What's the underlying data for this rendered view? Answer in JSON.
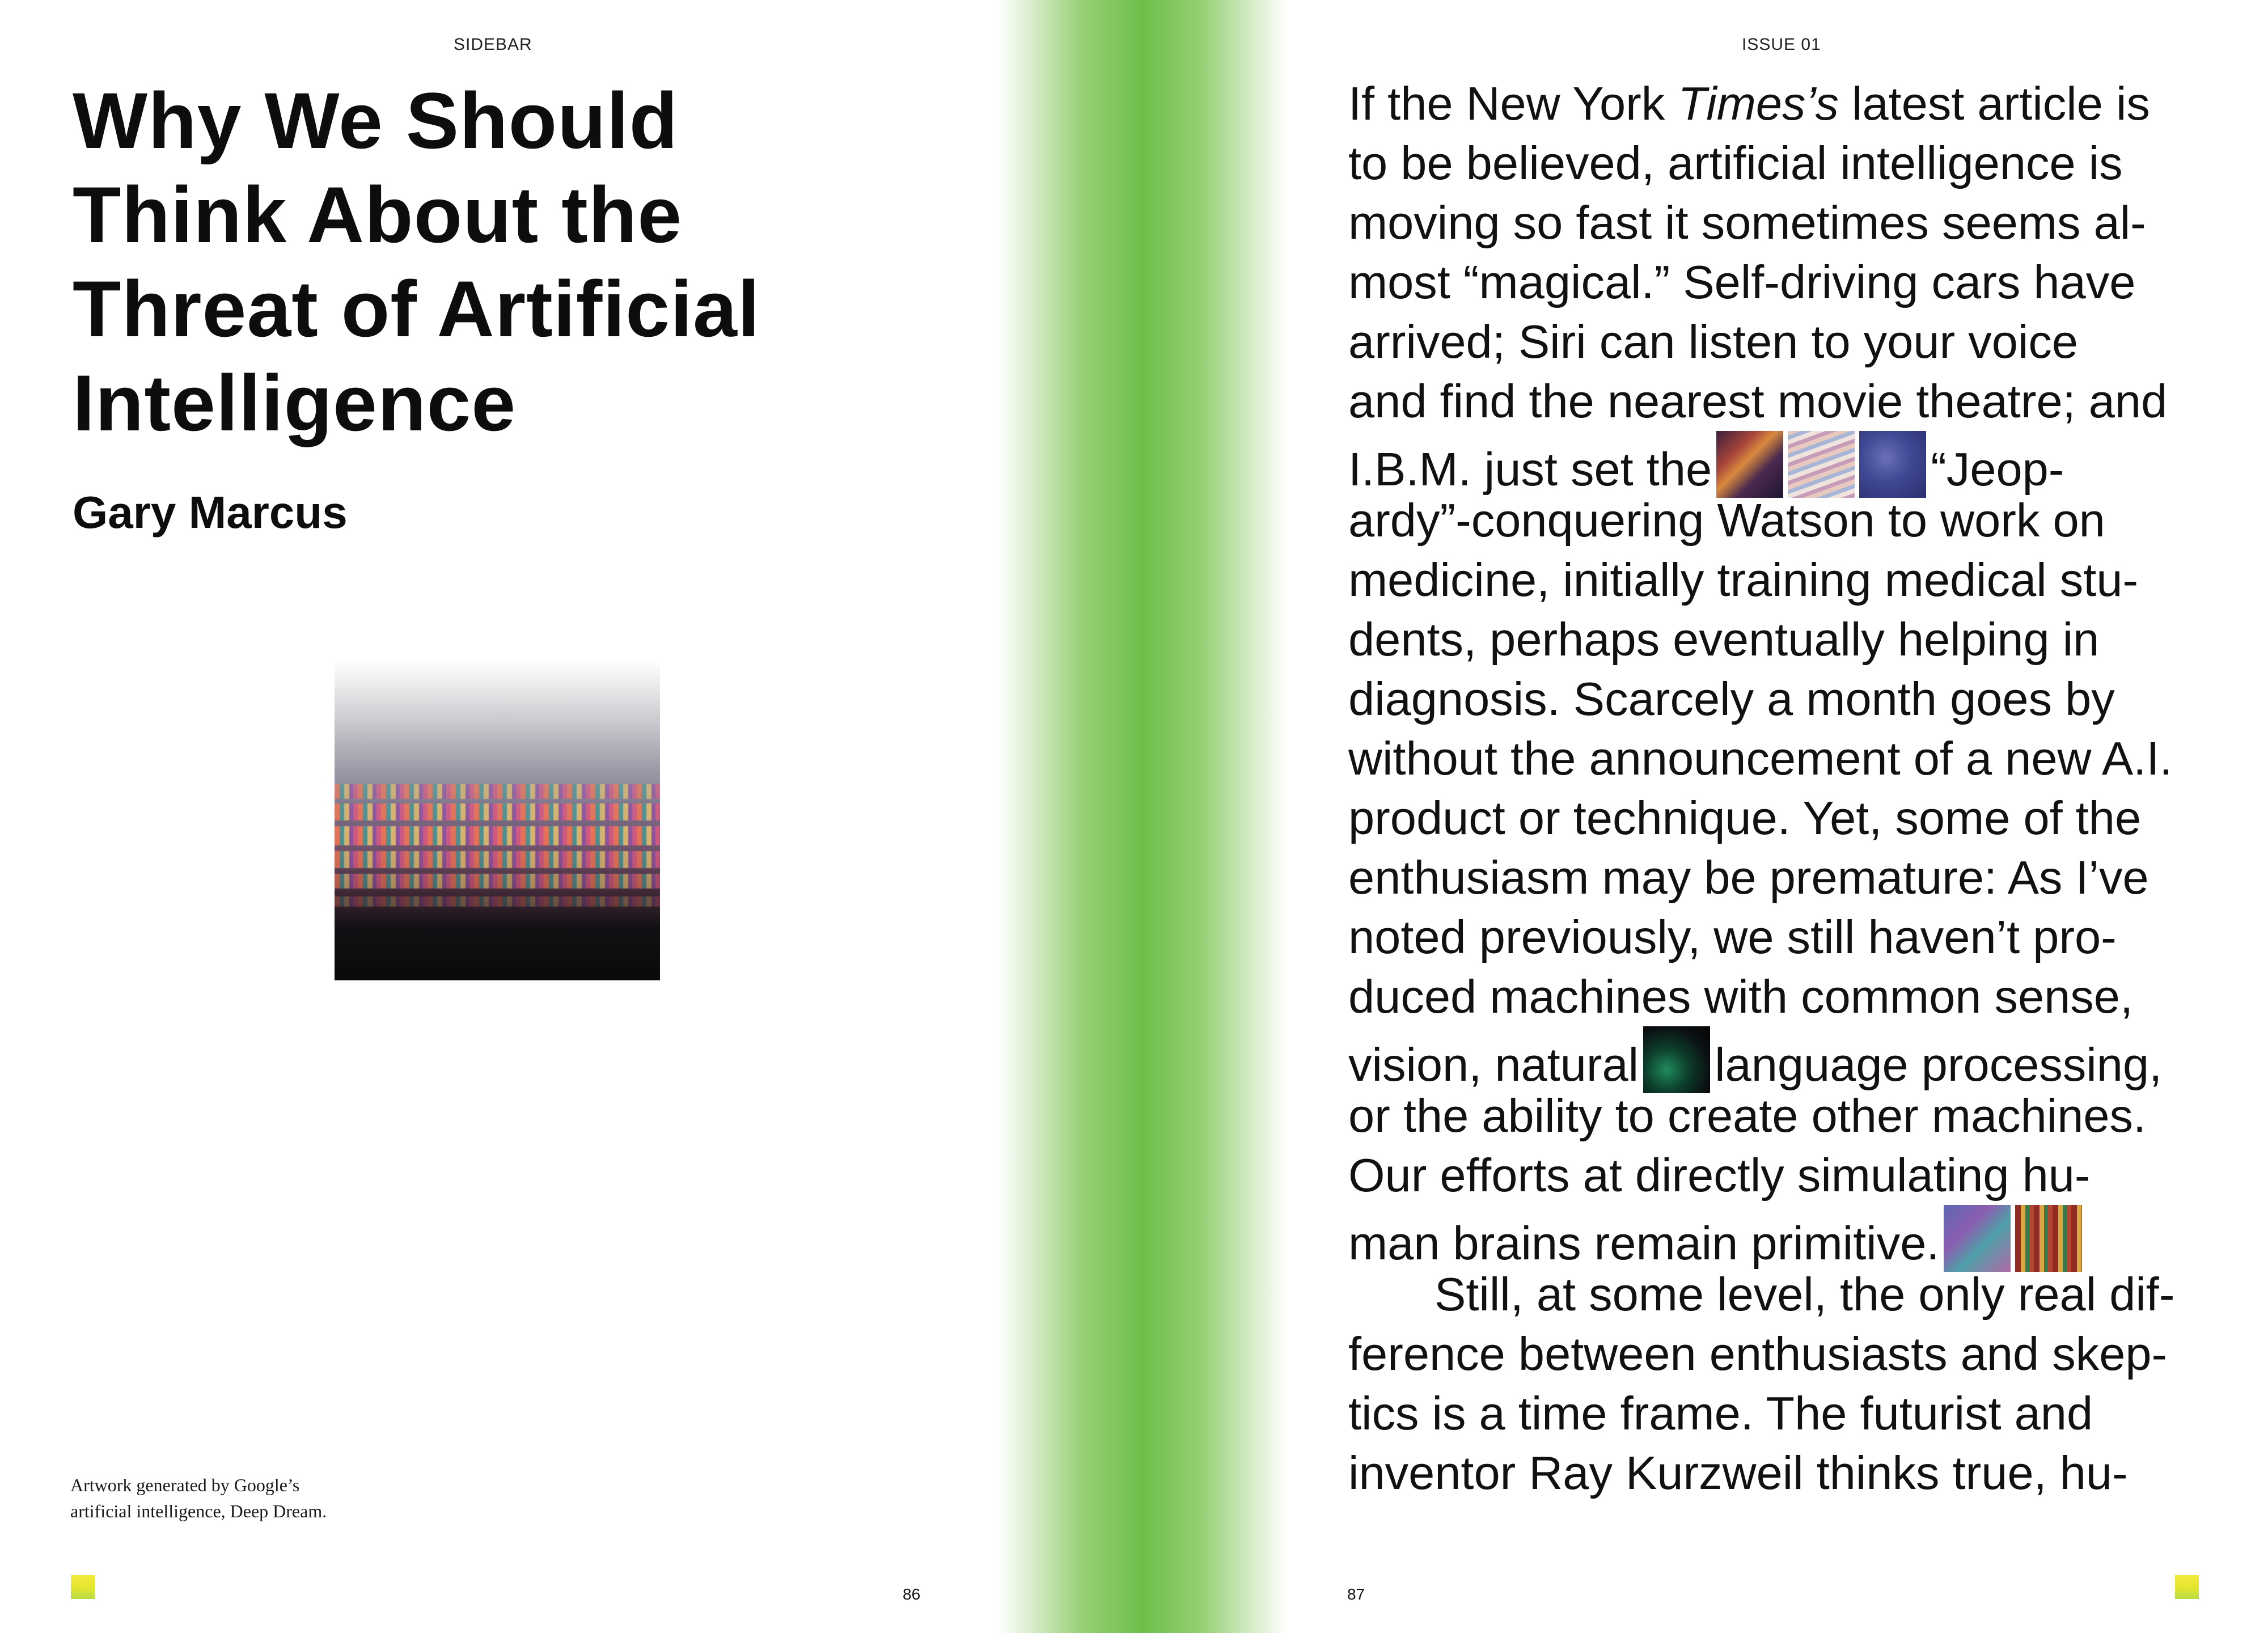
{
  "left_page": {
    "running_head": "SIDEBAR",
    "title_lines": [
      "Why We Should",
      "Think About the",
      "Threat of Artificial",
      "Intelligence"
    ],
    "author": "Gary Marcus",
    "caption_lines": [
      "Artwork generated by Google’s",
      "artificial intelligence, Deep Dream."
    ],
    "folio": "86"
  },
  "right_page": {
    "running_head": "ISSUE 01",
    "folio": "87",
    "body_lines": {
      "l1a": "If the New York ",
      "l1b": "Times’s",
      "l1c": " latest article is",
      "l2": "to be believed, artificial intelligence is",
      "l3": "moving so fast it sometimes seems al-",
      "l4": "most “magical.” Self-driving cars have",
      "l5": "arrived; Siri can listen to your voice",
      "l6": "and find the nearest movie theatre; and",
      "l7a": "I.B.M. just set the",
      "l7b": "“Jeop-",
      "l8": "ardy”-conquering Watson to work on",
      "l9": "medicine, initially training medical stu-",
      "l10": "dents, perhaps eventually helping in",
      "l11": "diagnosis. Scarcely a month goes by",
      "l12": "without the announcement of a new A.I.",
      "l13": "product or technique. Yet, some of the",
      "l14": "enthusiasm may be premature: As I’ve",
      "l15": "noted previously, we still haven’t pro-",
      "l16": "duced machines with common sense,",
      "l17a": "vision, natural",
      "l17b": "language processing,",
      "l18": "or the ability to create other machines.",
      "l19": "Our efforts at directly simulating hu-",
      "l20": "man brains remain primitive.",
      "l21": "Still, at some level, the only real dif-",
      "l22": "ference between enthusiasts and skep-",
      "l23": "tics is a time frame. The futurist and",
      "l24": "inventor Ray Kurzweil thinks true, hu-"
    }
  },
  "colors": {
    "gutter_green": "#6ebf4a",
    "marker_yellow": "#f2ea3a",
    "text": "#111111"
  }
}
